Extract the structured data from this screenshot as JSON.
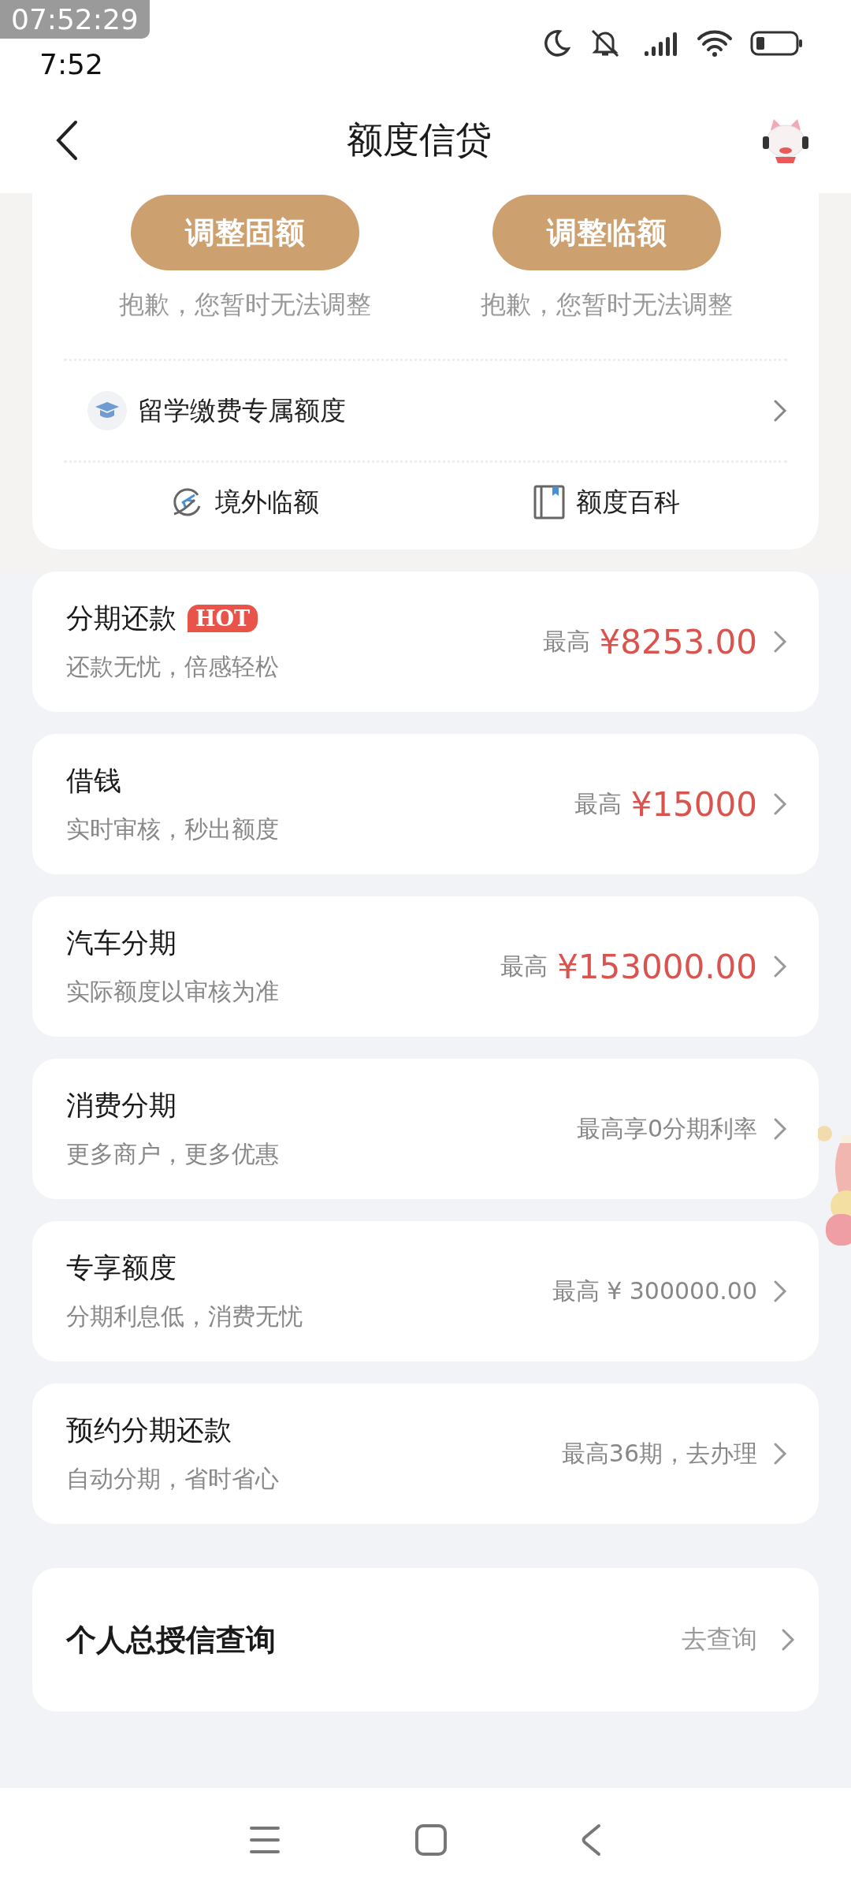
{
  "recorder_overlay": {
    "time": "07:52:29"
  },
  "status_bar": {
    "time": "7:52"
  },
  "header": {
    "title": "额度信贷"
  },
  "adjust_card": {
    "actions": [
      {
        "label": "调整固额",
        "note": "抱歉，您暂时无法调整"
      },
      {
        "label": "调整临额",
        "note": "抱歉，您暂时无法调整"
      }
    ],
    "study_row": {
      "label": "留学缴费专属额度"
    },
    "links": [
      {
        "kind": "overseas",
        "label": "境外临额"
      },
      {
        "kind": "wiki",
        "label": "额度百科"
      }
    ]
  },
  "products": [
    {
      "title": "分期还款",
      "badge": "HOT",
      "subtitle": "还款无忧，倍感轻松",
      "kind": "price",
      "prefix": "最高",
      "value": "¥8253.00"
    },
    {
      "title": "借钱",
      "subtitle": "实时审核，秒出额度",
      "kind": "price",
      "prefix": "最高",
      "value": "¥15000"
    },
    {
      "title": "汽车分期",
      "subtitle": "实际额度以审核为准",
      "kind": "price",
      "prefix": "最高",
      "value": "¥153000.00"
    },
    {
      "title": "消费分期",
      "subtitle": "更多商户，更多优惠",
      "kind": "text",
      "value": "最高享0分期利率"
    },
    {
      "title": "专享额度",
      "subtitle": "分期利息低，消费无忧",
      "kind": "text",
      "value": "最高 ¥ 300000.00"
    },
    {
      "title": "预约分期还款",
      "subtitle": "自动分期，省时省心",
      "kind": "text",
      "value": "最高36期，去办理"
    }
  ],
  "credit_query": {
    "title": "个人总授信查询",
    "action": "去查询"
  }
}
